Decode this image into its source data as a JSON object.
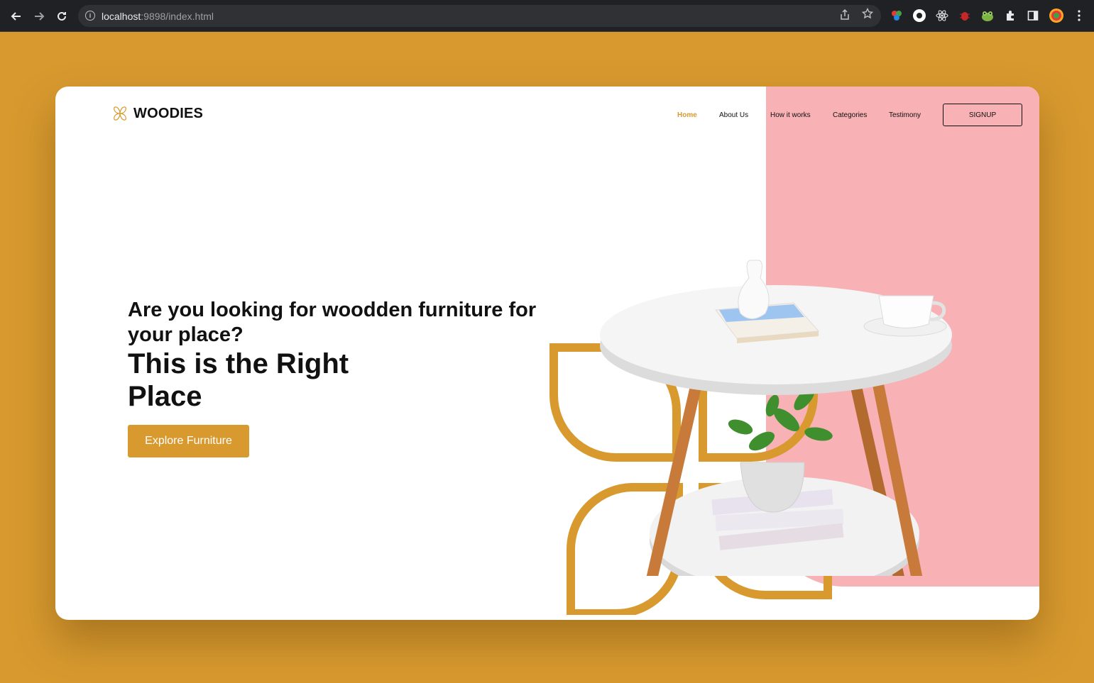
{
  "browser": {
    "url_host": "localhost",
    "url_rest": ":9898/index.html"
  },
  "site": {
    "logo_text": "WOODIES",
    "nav": [
      {
        "label": "Home",
        "active": true
      },
      {
        "label": "About Us"
      },
      {
        "label": "How it works"
      },
      {
        "label": "Categories"
      },
      {
        "label": "Testimony"
      }
    ],
    "signup_label": "SIGNUP"
  },
  "hero": {
    "question": "Are you looking for woodden furniture for your place?",
    "headline": "This is the Right Place",
    "cta_label": "Explore Furniture"
  },
  "colors": {
    "accent": "#d89a2f",
    "pink": "#f8b1b4",
    "page_bg": "#d89a2f"
  },
  "icons": [
    "back-arrow-icon",
    "forward-arrow-icon",
    "reload-icon",
    "info-icon",
    "share-icon",
    "star-icon",
    "extensions-icon",
    "sidepanel-icon",
    "profile-avatar-icon",
    "kebab-menu-icon",
    "flower-logo-icon"
  ]
}
